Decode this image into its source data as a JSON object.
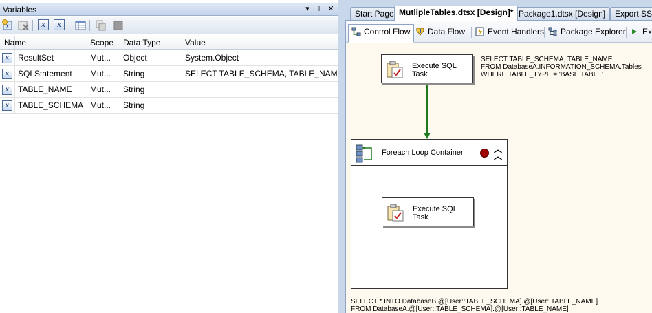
{
  "variables_pane": {
    "title": "Variables",
    "title_buttons": [
      "▾",
      "⊤",
      "✕"
    ],
    "toolbar_icons": [
      "add-variable-icon",
      "delete-variable-icon",
      "show-system-variables-icon",
      "show-all-variables-icon",
      "choose-columns-icon",
      "move-variable-icon",
      "copy-variable-icon"
    ],
    "columns": [
      "Name",
      "Scope",
      "Data Type",
      "Value"
    ],
    "rows": [
      {
        "name": "ResultSet",
        "scope": "Mut...",
        "type": "Object",
        "value": "System.Object"
      },
      {
        "name": "SQLStatement",
        "scope": "Mut...",
        "type": "String",
        "value": "SELECT TABLE_SCHEMA, TABLE_NAME  F"
      },
      {
        "name": "TABLE_NAME",
        "scope": "Mut...",
        "type": "String",
        "value": ""
      },
      {
        "name": "TABLE_SCHEMA",
        "scope": "Mut...",
        "type": "String",
        "value": ""
      }
    ]
  },
  "doc_tabs": [
    "Start Page",
    "MutlipleTables.dtsx [Design]*",
    "Package1.dtsx [Design]",
    "Export SSI"
  ],
  "designer_tabs": [
    "Control Flow",
    "Data Flow",
    "Event Handlers",
    "Package Explorer",
    "Exe"
  ],
  "canvas": {
    "task_top_label": "Execute SQL Task",
    "task_inner_label": "Execute SQL Task",
    "container_label": "Foreach Loop Container",
    "annotation_top": "SELECT TABLE_SCHEMA, TABLE_NAME\nFROM DatabaseA.INFORMATION_SCHEMA.Tables\nWHERE TABLE_TYPE = 'BASE TABLE'",
    "annotation_bottom": "SELECT * INTO DatabaseB.@[User::TABLE_SCHEMA].@[User::TABLE_NAME]\nFROM DatabaseA.@[User::TABLE_SCHEMA].@[User::TABLE_NAME]"
  },
  "colors": {
    "precedence_arrow": "#1f7a1f",
    "breakpoint": "#a00000",
    "canvas_bg": "#fdf9ee",
    "chrome_bg": "#c9d7ea"
  }
}
